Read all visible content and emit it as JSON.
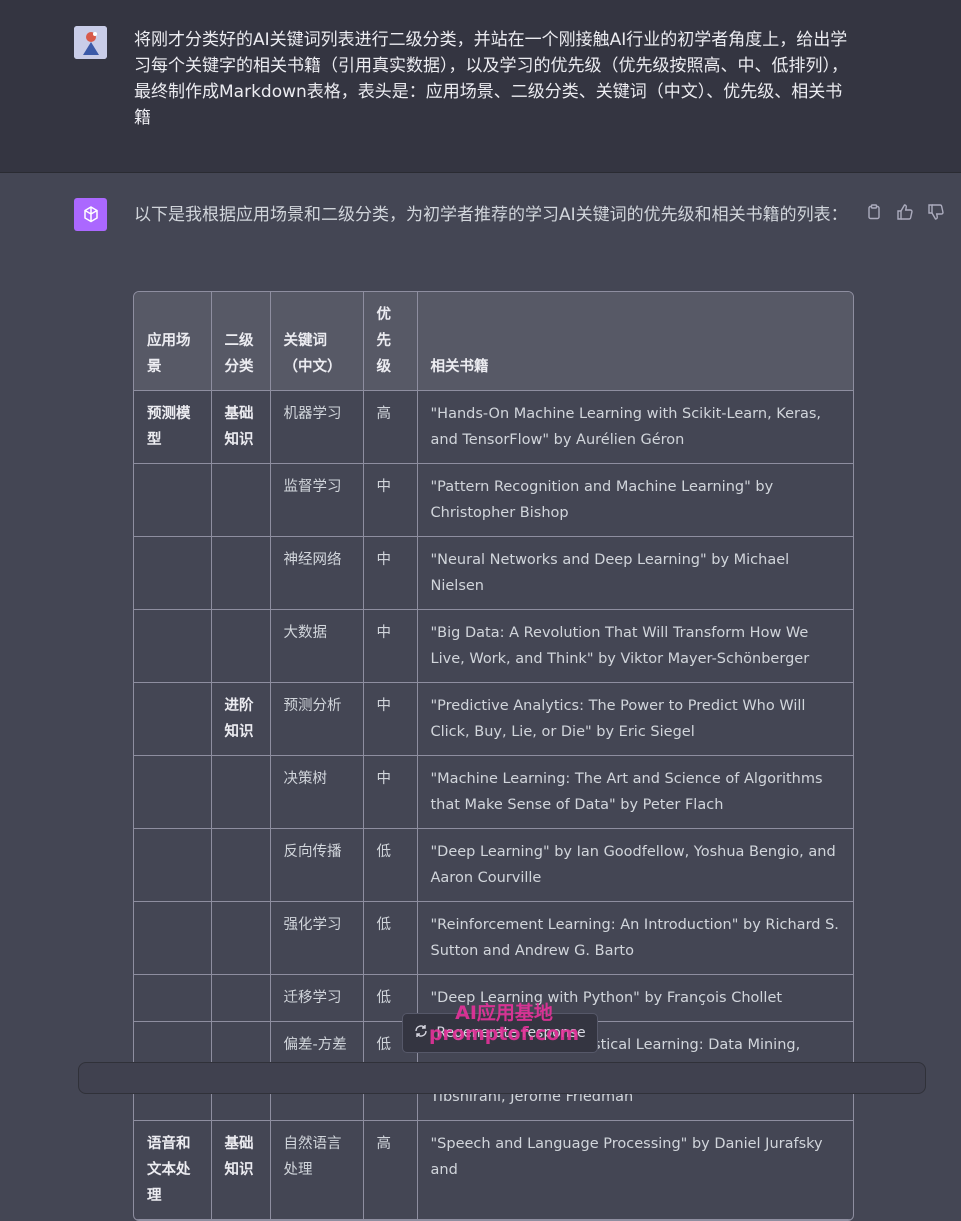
{
  "user": {
    "avatar": "user-avatar-icon",
    "message": "将刚才分类好的AI关键词列表进行二级分类，并站在一个刚接触AI行业的初学者角度上，给出学习每个关键字的相关书籍（引用真实数据），以及学习的优先级（优先级按照高、中、低排列），最终制作成Markdown表格，表头是：应用场景、二级分类、关键词（中文）、优先级、相关书籍"
  },
  "assistant": {
    "avatar": "chatgpt-logo-icon",
    "intro": "以下是我根据应用场景和二级分类，为初学者推荐的学习AI关键词的优先级和相关书籍的列表：",
    "actions": [
      "copy-icon",
      "thumbs-up-icon",
      "thumbs-down-icon"
    ]
  },
  "table": {
    "headers": [
      "应用场景",
      "二级分类",
      "关键词（中文）",
      "优先级",
      "相关书籍"
    ],
    "rows": [
      [
        "预测模型",
        "基础知识",
        "机器学习",
        "高",
        "\"Hands-On Machine Learning with Scikit-Learn, Keras, and TensorFlow\" by Aurélien Géron"
      ],
      [
        "",
        "",
        "监督学习",
        "中",
        "\"Pattern Recognition and Machine Learning\" by Christopher Bishop"
      ],
      [
        "",
        "",
        "神经网络",
        "中",
        "\"Neural Networks and Deep Learning\" by Michael Nielsen"
      ],
      [
        "",
        "",
        "大数据",
        "中",
        "\"Big Data: A Revolution That Will Transform How We Live, Work, and Think\" by Viktor Mayer-Schönberger"
      ],
      [
        "",
        "进阶知识",
        "预测分析",
        "中",
        "\"Predictive Analytics: The Power to Predict Who Will Click, Buy, Lie, or Die\" by Eric Siegel"
      ],
      [
        "",
        "",
        "决策树",
        "中",
        "\"Machine Learning: The Art and Science of Algorithms that Make Sense of Data\" by Peter Flach"
      ],
      [
        "",
        "",
        "反向传播",
        "低",
        "\"Deep Learning\" by Ian Goodfellow, Yoshua Bengio, and Aaron Courville"
      ],
      [
        "",
        "",
        "强化学习",
        "低",
        "\"Reinforcement Learning: An Introduction\" by Richard S. Sutton and Andrew G. Barto"
      ],
      [
        "",
        "",
        "迁移学习",
        "低",
        "\"Deep Learning with Python\" by François Chollet"
      ],
      [
        "",
        "",
        "偏差-方差权衡",
        "低",
        "\"The Elements of Statistical Learning: Data Mining, Inference, and Prediction\" by Trevor Hastie, Robert Tibshirani, Jerome Friedman"
      ],
      [
        "语音和文本处理",
        "基础知识",
        "自然语言处理",
        "高",
        "\"Speech and Language Processing\" by Daniel Jurafsky and"
      ]
    ]
  },
  "regenerate": {
    "label": "Regenerate response",
    "icon": "refresh-icon"
  },
  "watermark": {
    "line1": "AI应用基地",
    "line2": "promptof.com"
  },
  "colors": {
    "accent": "#ab68ff",
    "watermark": "#e6329a"
  }
}
